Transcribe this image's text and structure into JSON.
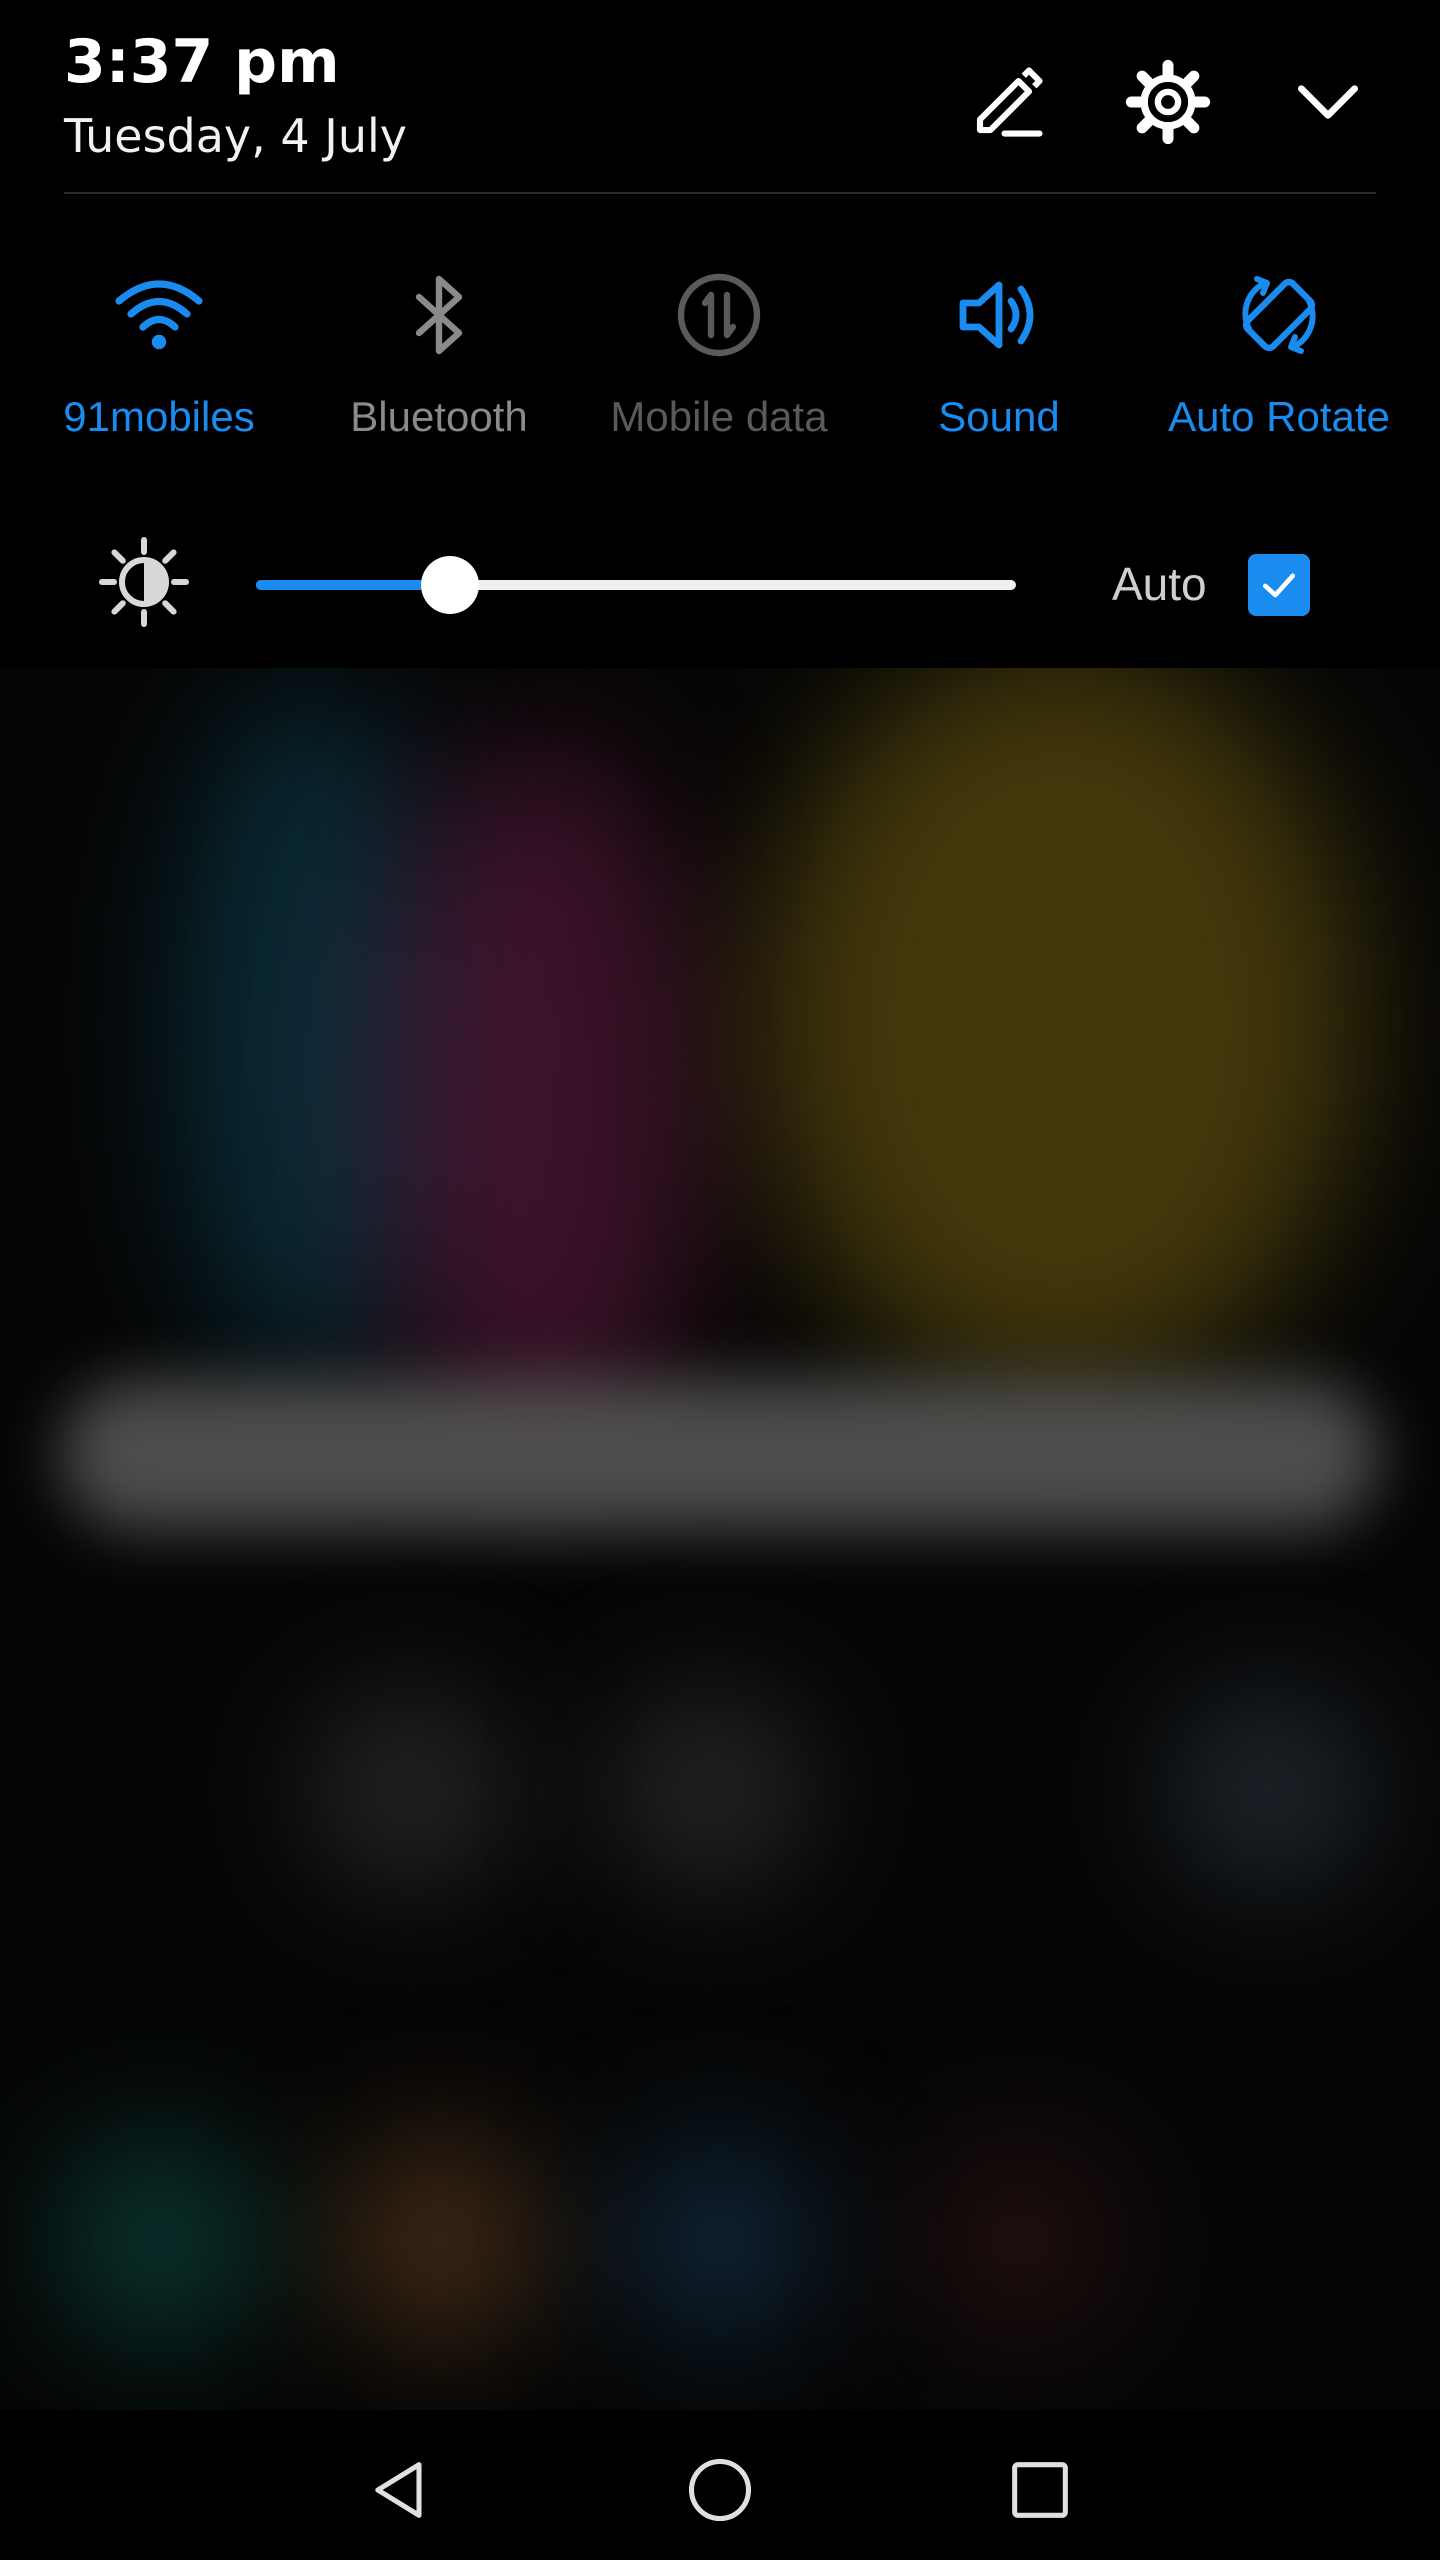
{
  "status": {
    "time": "3:37 pm",
    "date": "Tuesday, 4 July"
  },
  "colors": {
    "accent": "#1a8cf0",
    "inactive": "#8a8a8a",
    "disabled": "#5a5a5a"
  },
  "toolbar": {
    "edit_icon": "pencil-icon",
    "settings_icon": "gear-icon",
    "collapse_icon": "chevron-down-icon"
  },
  "tiles": [
    {
      "label": "91mobiles",
      "icon": "wifi-icon",
      "state": "on"
    },
    {
      "label": "Bluetooth",
      "icon": "bluetooth-icon",
      "state": "off"
    },
    {
      "label": "Mobile data",
      "icon": "mobile-data-icon",
      "state": "disabled"
    },
    {
      "label": "Sound",
      "icon": "speaker-icon",
      "state": "on"
    },
    {
      "label": "Auto Rotate",
      "icon": "auto-rotate-icon",
      "state": "on"
    }
  ],
  "brightness": {
    "icon": "brightness-icon",
    "level": 0.255,
    "auto_label": "Auto",
    "auto_checked": true
  },
  "navigation": {
    "back_icon": "back-triangle-icon",
    "home_icon": "home-circle-icon",
    "recents_icon": "recents-square-icon"
  }
}
